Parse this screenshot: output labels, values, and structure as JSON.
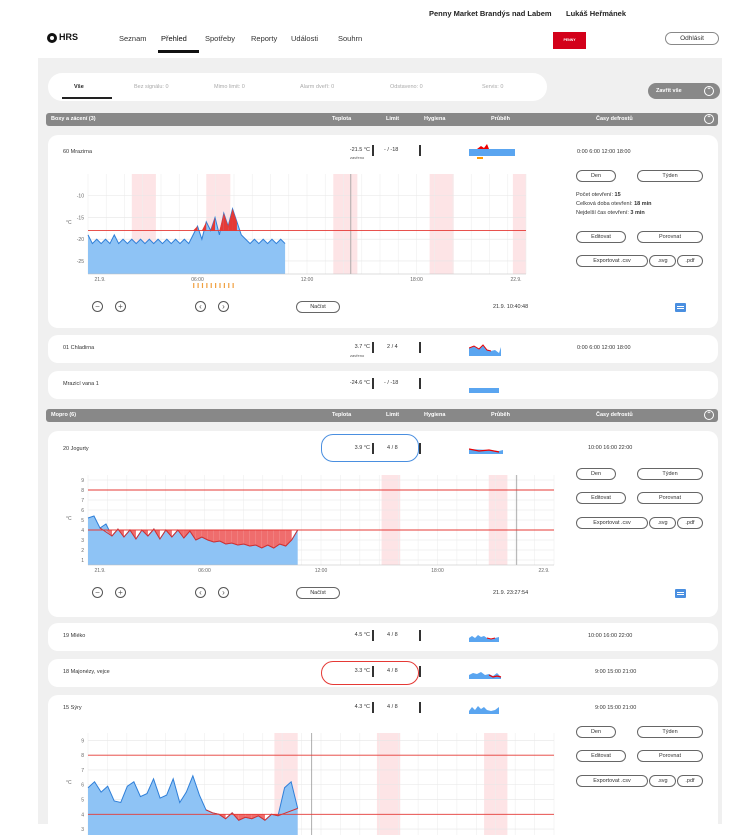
{
  "header": {
    "logo": "HRS",
    "nav": [
      "Seznam",
      "Přehled",
      "Spotřeby",
      "Reporty",
      "Události",
      "Souhrn"
    ],
    "store": "Penny Market Brandýs nad Labem",
    "user": "Lukáš Heřmánek",
    "brand": "PENNY",
    "logout": "Odhlásit"
  },
  "filters": [
    {
      "label": "Vše",
      "active": true
    },
    {
      "label": "Bez signálu: 0"
    },
    {
      "label": "Mimo limit: 0"
    },
    {
      "label": "Alarm dveří: 0"
    },
    {
      "label": "Odstaveno: 0"
    },
    {
      "label": "Servis: 0"
    }
  ],
  "close_all": "Zavřít vše",
  "groups": [
    {
      "title": "Boxy a zácení (3)",
      "cols": [
        "Teplota",
        "Limit",
        "Hygiena",
        "Průběh",
        "Časy defrostů"
      ]
    },
    {
      "title": "Mopro (6)",
      "cols": [
        "Teplota",
        "Limit",
        "Hygiena",
        "Průběh",
        "Časy defrostů"
      ]
    }
  ],
  "rows": {
    "r1": {
      "name": "60 Mrazirna",
      "temp": "-21.5 °C",
      "limit": "- / -18",
      "note": "zavřeno",
      "times": "0:00   6:00   12:00   18:00"
    },
    "r2": {
      "name": "01 Chladirna",
      "temp": "3.7 °C",
      "limit": "2 / 4",
      "note": "zavřeno",
      "times": "0:00   6:00   12:00   18:00"
    },
    "r3": {
      "name": "Mrazicí vana 1",
      "temp": "-24.6 °C",
      "limit": "- / -18"
    },
    "r4": {
      "name": "20 Jogurty",
      "temp": "3.9 °C",
      "limit": "4 / 8",
      "times": "10:00   16:00   22:00"
    },
    "r5": {
      "name": "19 Mléko",
      "temp": "4.5 °C",
      "limit": "4 / 8",
      "times": "10:00   16:00   22:00"
    },
    "r6": {
      "name": "18 Majonézy, vejce",
      "temp": "3.3 °C",
      "limit": "4 / 8",
      "times": "9:00   15:00   21:00"
    },
    "r7": {
      "name": "15 Sýry",
      "temp": "4.3 °C",
      "limit": "4 / 8",
      "times": "9:00   15:00   21:00"
    }
  },
  "buttons": {
    "day": "Den",
    "week": "Týden",
    "edit": "Editovat",
    "compare": "Porovnat",
    "csv": "Exportovat .csv",
    "svg": ".svg",
    "pdf": ".pdf",
    "load": "Načíst"
  },
  "stats": {
    "opens_label": "Počet otevření:",
    "opens": "15",
    "dur_label": "Celková doba otevření:",
    "dur": "18 min",
    "long_label": "Nejdelší čas otevření:",
    "long": "3 min"
  },
  "timestamps": {
    "t1": "21.9. 10:40:48",
    "t4": "21.9. 23:27:54"
  },
  "chart_data": [
    {
      "type": "area",
      "name": "60 Mrazirna",
      "ylabel": "°C",
      "yticks": [
        -10,
        -15,
        -20,
        -25
      ],
      "ylim": [
        -28,
        -5
      ],
      "limit": -18,
      "xticks": [
        "21.9.",
        "06:00",
        "12:00",
        "18:00",
        "22.9."
      ],
      "values": [
        -19,
        -21,
        -20,
        -21,
        -20,
        -21,
        -19,
        -21,
        -20,
        -21,
        -20,
        -21,
        -20,
        -21,
        -20,
        -21,
        -20,
        -21,
        -20,
        -21,
        -20,
        -21,
        -20,
        -21,
        -19,
        -17,
        -20,
        -16,
        -18,
        -15,
        -19,
        -14,
        -17,
        -13,
        -16,
        -19,
        -20,
        -21,
        -20,
        -21,
        -20,
        -21,
        -20,
        -21,
        -20,
        -21
      ]
    },
    {
      "type": "area",
      "name": "20 Jogurty",
      "ylabel": "°C",
      "yticks": [
        1,
        2,
        3,
        4,
        5,
        6,
        7,
        8,
        9
      ],
      "ylim": [
        0.5,
        9.5
      ],
      "limit_low": 4,
      "limit_high": 8,
      "xticks": [
        "21.9.",
        "06:00",
        "12:00",
        "18:00",
        "22.9."
      ],
      "values": [
        5.2,
        5.4,
        4.2,
        4.6,
        3.4,
        4.1,
        3.3,
        4.0,
        3.1,
        4.0,
        3.4,
        4.1,
        3.1,
        4.0,
        3.3,
        4.0,
        3.2,
        3.9,
        3.0,
        3.3,
        3.0,
        2.8,
        2.9,
        2.6,
        2.7,
        2.5,
        2.6,
        2.4,
        2.5,
        2.2,
        2.5,
        2.2,
        2.6,
        2.4,
        3.0,
        4.0
      ]
    },
    {
      "type": "area",
      "name": "15 Sýry",
      "ylabel": "°C",
      "yticks": [
        3,
        4,
        5,
        6,
        7,
        8,
        9
      ],
      "ylim": [
        2.6,
        9.5
      ],
      "limit_low": 4,
      "limit_high": 8,
      "xticks": [],
      "values": [
        5.8,
        6.2,
        5.5,
        5.9,
        4.9,
        4.8,
        5.9,
        6.2,
        5.2,
        5.4,
        6.4,
        5.1,
        5.3,
        6.4,
        4.8,
        5.5,
        6.6,
        5.3,
        4.3,
        4.1,
        4.0,
        3.7,
        4.1,
        3.6,
        3.8,
        3.7,
        3.9,
        3.6,
        4.0,
        3.9,
        5.8,
        6.2,
        4.4
      ]
    }
  ]
}
